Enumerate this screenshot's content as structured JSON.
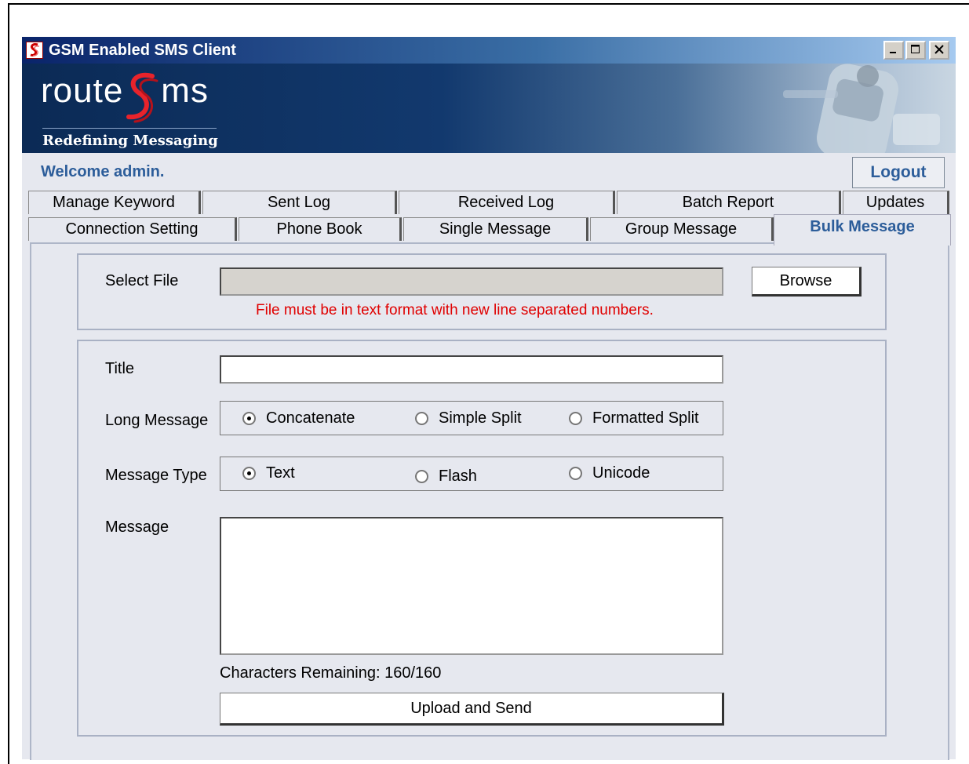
{
  "window": {
    "title": "GSM Enabled SMS Client",
    "controls": {
      "minimize": "minimize-icon",
      "maximize": "maximize-icon",
      "close": "close-icon"
    }
  },
  "banner": {
    "logo_left": "route",
    "logo_right": "ms",
    "tagline": "Redefining Messaging"
  },
  "header": {
    "welcome": "Welcome admin.",
    "logout_label": "Logout"
  },
  "tabs": {
    "row1": [
      "Manage Keyword",
      "Sent Log",
      "Received Log",
      "Batch Report",
      "Updates"
    ],
    "row2": [
      "Connection Setting",
      "Phone Book",
      "Single Message",
      "Group Message",
      "Bulk Message"
    ],
    "active": "Bulk Message"
  },
  "bulk": {
    "select_file_label": "Select File",
    "file_value": "",
    "browse_label": "Browse",
    "file_hint": "File must be in text format with new line separated numbers.",
    "title_label": "Title",
    "title_value": "",
    "long_message_label": "Long Message",
    "long_message_options": [
      "Concatenate",
      "Simple Split",
      "Formatted Split"
    ],
    "long_message_selected": "Concatenate",
    "message_type_label": "Message Type",
    "message_type_options": [
      "Text",
      "Flash",
      "Unicode"
    ],
    "message_type_selected": "Text",
    "message_label": "Message",
    "message_value": "",
    "chars_remaining": "Characters Remaining: 160/160",
    "submit_label": "Upload and Send"
  },
  "colors": {
    "accent": "#2c5d9a",
    "hint": "#e00000",
    "panel": "#e6e8ef",
    "titlebar": "#0a246a"
  }
}
